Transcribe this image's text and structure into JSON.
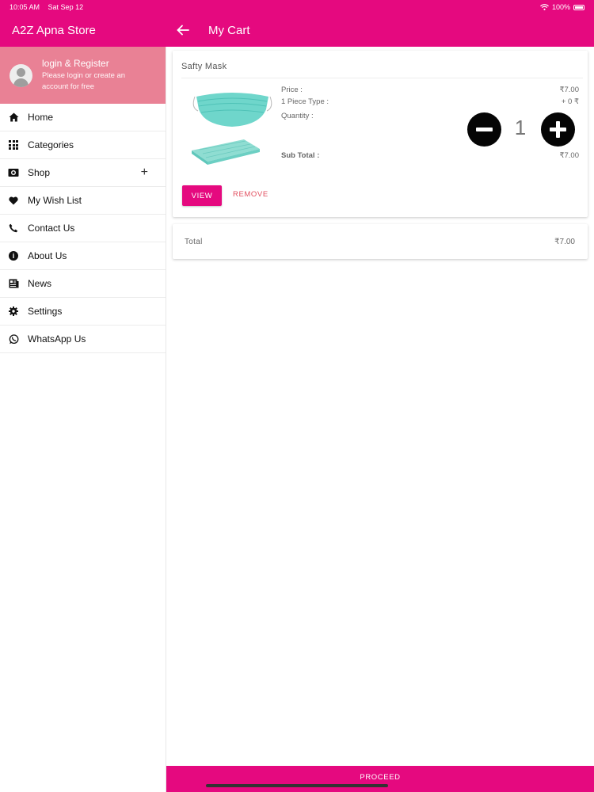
{
  "status_bar": {
    "time": "10:05 AM",
    "date": "Sat Sep 12",
    "battery": "100%"
  },
  "app": {
    "store_name": "A2Z Apna Store",
    "page_title": "My Cart",
    "primary_color": "#e5097f"
  },
  "drawer": {
    "profile": {
      "title": "login & Register",
      "subtitle": "Please login or create an account for free"
    },
    "items": [
      {
        "label": "Home",
        "icon": "home-icon"
      },
      {
        "label": "Categories",
        "icon": "grid-icon"
      },
      {
        "label": "Shop",
        "icon": "shop-icon",
        "expand": "+"
      },
      {
        "label": "My Wish List",
        "icon": "heart-icon"
      },
      {
        "label": "Contact Us",
        "icon": "phone-icon"
      },
      {
        "label": "About Us",
        "icon": "info-icon"
      },
      {
        "label": "News",
        "icon": "news-icon"
      },
      {
        "label": "Settings",
        "icon": "gear-icon"
      },
      {
        "label": "WhatsApp Us",
        "icon": "whatsapp-icon"
      }
    ]
  },
  "cart": {
    "item": {
      "name": "Safty Mask",
      "price_label": "Price :",
      "price_value": "₹7.00",
      "type_label": "1 Piece Type :",
      "type_value": "+ 0 ₹",
      "quantity_label": "Quantity  :",
      "quantity": "1",
      "subtotal_label": "Sub Total :",
      "subtotal_value": "₹7.00",
      "view_label": "VIEW",
      "remove_label": "REMOVE"
    },
    "total_label": "Total",
    "total_value": "₹7.00",
    "proceed_label": "PROCEED"
  }
}
